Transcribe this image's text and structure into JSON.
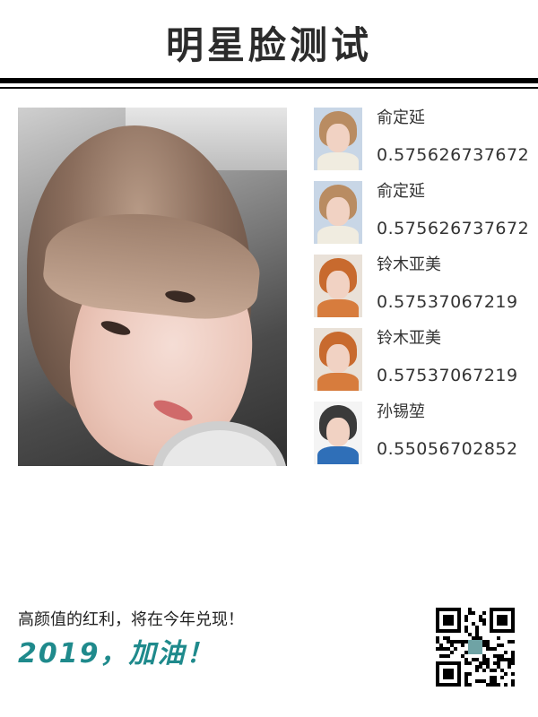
{
  "header": {
    "title": "明星脸测试"
  },
  "colors": {
    "accent": "#1f8a8c",
    "rule": "#000000"
  },
  "main_photo": {
    "icon": "uploaded-face-photo"
  },
  "results": [
    {
      "name": "俞定延",
      "score": "0.575626737672",
      "thumb_colors": {
        "bg": "#c8d6e6",
        "hair": "#b98c62",
        "body": "#f0ece0"
      }
    },
    {
      "name": "俞定延",
      "score": "0.575626737672",
      "thumb_colors": {
        "bg": "#c8d6e6",
        "hair": "#b98c62",
        "body": "#f0ece0"
      }
    },
    {
      "name": "铃木亚美",
      "score": "0.57537067219",
      "thumb_colors": {
        "bg": "#e9e1d8",
        "hair": "#c86a2e",
        "body": "#d77c3d"
      }
    },
    {
      "name": "铃木亚美",
      "score": "0.57537067219",
      "thumb_colors": {
        "bg": "#e9e1d8",
        "hair": "#c86a2e",
        "body": "#d77c3d"
      }
    },
    {
      "name": "孙锡堃",
      "score": "0.55056702852",
      "thumb_colors": {
        "bg": "#f4f4f4",
        "hair": "#3a3a3a",
        "body": "#2f6fb8"
      }
    }
  ],
  "footer": {
    "slogan": "高颜值的红利，将在今年兑现！",
    "cheer": "2019，加油！",
    "qr_icon": "qr-code-icon"
  }
}
